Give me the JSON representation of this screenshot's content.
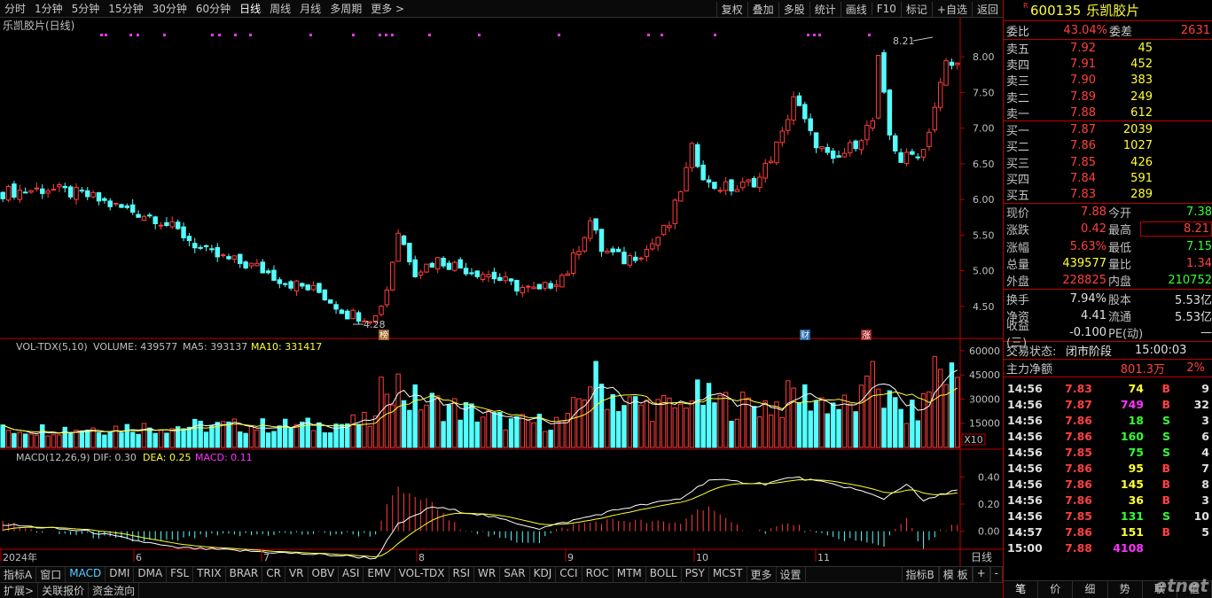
{
  "toolbar": {
    "periods": [
      "分时",
      "1分钟",
      "5分钟",
      "15分钟",
      "30分钟",
      "60分钟",
      "日线",
      "周线",
      "月线",
      "多周期",
      "更多 >"
    ],
    "right": [
      "复权",
      "叠加",
      "多股",
      "统计",
      "画线",
      "F10",
      "标记",
      "+自选",
      "返回"
    ]
  },
  "main": {
    "title": "乐凯胶片(日线)",
    "high_label": "8.21",
    "low_label": "4.28",
    "y_ticks": [
      "8.00",
      "7.50",
      "7.00",
      "6.50",
      "6.00",
      "5.50",
      "5.00",
      "4.50"
    ],
    "markers": [
      {
        "text": "榜",
        "color": "#a06020"
      },
      {
        "text": "财",
        "color": "#2060a0"
      },
      {
        "text": "涨",
        "color": "#a02020"
      }
    ]
  },
  "volume": {
    "title": "VOL-TDX(5,10)",
    "volume": "VOLUME: 439577",
    "ma5": "MA5: 393137",
    "ma10": "MA10: 331417",
    "y_ticks": [
      "60000",
      "45000",
      "30000",
      "15000"
    ],
    "unit": "X10"
  },
  "macd": {
    "title": "MACD(12,26,9)",
    "dif": "DIF: 0.30",
    "dea": "DEA: 0.25",
    "macd": "MACD: 0.11",
    "y_ticks": [
      "0.40",
      "0.20",
      "0.00"
    ]
  },
  "x_axis": {
    "labels": [
      "2024年",
      "6",
      "7",
      "8",
      "9",
      "10",
      "11"
    ],
    "period": "日线"
  },
  "indicators": {
    "tabs": [
      "指标A",
      "窗口",
      "MACD",
      "DMI",
      "DMA",
      "FSL",
      "TRIX",
      "BRAR",
      "CR",
      "VR",
      "OBV",
      "ASI",
      "EMV",
      "VOL-TDX",
      "RSI",
      "WR",
      "SAR",
      "KDJ",
      "CCI",
      "ROC",
      "MTM",
      "BOLL",
      "PSY",
      "MCST",
      "更多",
      "设置"
    ],
    "right": [
      "指标B",
      "模 板",
      "+",
      "-"
    ]
  },
  "bottom_tabs": [
    "扩展>",
    "关联报价",
    "资金流向"
  ],
  "colors": {
    "up": "#ff3c3c",
    "down": "#54ffff",
    "accent": "#b00000"
  },
  "quote": {
    "code": "600135",
    "name": "乐凯胶片",
    "marker": "R",
    "weibi_l": "委比",
    "weibi": "43.04%",
    "weicha_l": "委差",
    "weicha": "2631",
    "asks": [
      [
        "卖五",
        "7.92",
        "45"
      ],
      [
        "卖四",
        "7.91",
        "452"
      ],
      [
        "卖三",
        "7.90",
        "383"
      ],
      [
        "卖二",
        "7.89",
        "249"
      ],
      [
        "卖一",
        "7.88",
        "612"
      ]
    ],
    "bids": [
      [
        "买一",
        "7.87",
        "2039"
      ],
      [
        "买二",
        "7.86",
        "1027"
      ],
      [
        "买三",
        "7.85",
        "426"
      ],
      [
        "买四",
        "7.84",
        "591"
      ],
      [
        "买五",
        "7.83",
        "289"
      ]
    ],
    "stats": [
      [
        "现价",
        "7.88",
        "今开",
        "7.38"
      ],
      [
        "涨跌",
        "0.42",
        "最高",
        "8.21"
      ],
      [
        "涨幅",
        "5.63%",
        "最低",
        "7.15"
      ],
      [
        "总量",
        "439577",
        "量比",
        "1.34"
      ],
      [
        "外盘",
        "228825",
        "内盘",
        "210752"
      ]
    ],
    "stats2": [
      [
        "换手",
        "7.94%",
        "股本",
        "5.53亿"
      ],
      [
        "净资",
        "4.41",
        "流通",
        "5.53亿"
      ],
      [
        "收益(三)",
        "-0.100",
        "PE(动)",
        "—"
      ]
    ],
    "status_l": "交易状态:",
    "status": "闭市阶段",
    "status_t": "15:00:03",
    "flow_l": "主力净额",
    "flow": "801.3万",
    "flow_pct": "2%",
    "trades": [
      [
        "14:56",
        "7.83",
        "74",
        "B",
        "9"
      ],
      [
        "14:56",
        "7.87",
        "749",
        "B",
        "32"
      ],
      [
        "14:56",
        "7.86",
        "18",
        "S",
        "3"
      ],
      [
        "14:56",
        "7.86",
        "160",
        "S",
        "6"
      ],
      [
        "14:56",
        "7.85",
        "75",
        "S",
        "4"
      ],
      [
        "14:56",
        "7.86",
        "95",
        "B",
        "7"
      ],
      [
        "14:56",
        "7.86",
        "145",
        "B",
        "8"
      ],
      [
        "14:56",
        "7.86",
        "36",
        "B",
        "3"
      ],
      [
        "14:56",
        "7.85",
        "131",
        "S",
        "10"
      ],
      [
        "14:57",
        "7.86",
        "151",
        "B",
        "5"
      ],
      [
        "15:00",
        "7.88",
        "4108",
        "",
        ""
      ]
    ],
    "tabs": [
      "笔",
      "价",
      "细",
      "势",
      "联",
      "值"
    ],
    "watermark": "etnet"
  },
  "chart_data": {
    "type": "candlestick",
    "close_points": [
      [
        0,
        6.1
      ],
      [
        8,
        6.15
      ],
      [
        15,
        6.05
      ],
      [
        20,
        5.9
      ],
      [
        27,
        5.75
      ],
      [
        32,
        5.5
      ],
      [
        36,
        5.25
      ],
      [
        40,
        5.15
      ],
      [
        45,
        5.05
      ],
      [
        50,
        4.85
      ],
      [
        56,
        4.7
      ],
      [
        61,
        4.4
      ],
      [
        66,
        4.35
      ],
      [
        68,
        4.75
      ],
      [
        70,
        5.55
      ],
      [
        73,
        5.0
      ],
      [
        77,
        5.15
      ],
      [
        81,
        5.05
      ],
      [
        86,
        4.95
      ],
      [
        90,
        4.8
      ],
      [
        95,
        4.7
      ],
      [
        100,
        5.0
      ],
      [
        104,
        5.7
      ],
      [
        106,
        5.3
      ],
      [
        110,
        5.15
      ],
      [
        114,
        5.3
      ],
      [
        118,
        5.65
      ],
      [
        121,
        6.4
      ],
      [
        122,
        6.7
      ],
      [
        125,
        6.2
      ],
      [
        130,
        6.15
      ],
      [
        134,
        6.3
      ],
      [
        138,
        6.9
      ],
      [
        140,
        7.45
      ],
      [
        143,
        6.9
      ],
      [
        147,
        6.5
      ],
      [
        151,
        6.8
      ],
      [
        154,
        7.1
      ],
      [
        155,
        7.95
      ],
      [
        157,
        6.9
      ],
      [
        159,
        6.55
      ],
      [
        163,
        6.7
      ],
      [
        165,
        7.3
      ],
      [
        167,
        7.9
      ],
      [
        168,
        7.88
      ]
    ],
    "vol_points": [
      [
        0,
        20
      ],
      [
        30,
        24
      ],
      [
        55,
        25
      ],
      [
        66,
        30
      ],
      [
        68,
        88
      ],
      [
        72,
        55
      ],
      [
        80,
        45
      ],
      [
        90,
        28
      ],
      [
        100,
        30
      ],
      [
        104,
        80
      ],
      [
        110,
        50
      ],
      [
        120,
        45
      ],
      [
        121,
        60
      ],
      [
        124,
        55
      ],
      [
        130,
        48
      ],
      [
        138,
        50
      ],
      [
        140,
        62
      ],
      [
        150,
        45
      ],
      [
        153,
        60
      ],
      [
        154,
        105
      ],
      [
        156,
        58
      ],
      [
        160,
        35
      ],
      [
        163,
        48
      ],
      [
        165,
        95
      ],
      [
        168,
        82
      ]
    ],
    "macd_points": [
      [
        0,
        0.05
      ],
      [
        15,
        0.0
      ],
      [
        30,
        -0.12
      ],
      [
        45,
        -0.15
      ],
      [
        60,
        -0.18
      ],
      [
        66,
        -0.2
      ],
      [
        70,
        0.05
      ],
      [
        76,
        0.18
      ],
      [
        85,
        0.12
      ],
      [
        95,
        0.02
      ],
      [
        103,
        0.1
      ],
      [
        110,
        0.17
      ],
      [
        120,
        0.24
      ],
      [
        125,
        0.38
      ],
      [
        135,
        0.35
      ],
      [
        140,
        0.4
      ],
      [
        150,
        0.32
      ],
      [
        156,
        0.24
      ],
      [
        160,
        0.35
      ],
      [
        163,
        0.22
      ],
      [
        168,
        0.3
      ]
    ],
    "y_range": [
      4.2,
      8.35
    ],
    "vol_max": 66000,
    "macd_range": [
      -0.12,
      0.5
    ]
  }
}
